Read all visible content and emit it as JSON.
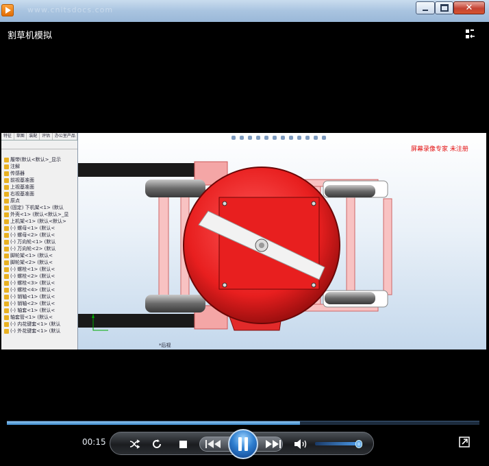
{
  "window": {
    "watermark": "www.cnitsdocs.com",
    "minimize_label": "",
    "maximize_label": "",
    "close_label": "✕"
  },
  "video": {
    "title": "割草机模拟",
    "cad_tabs": [
      "特征",
      "草图",
      "装配",
      "评估",
      "办公室产品"
    ],
    "tree_items": [
      "履带(默认<默认>_显示",
      "注解",
      "传感器",
      "前视基准面",
      "上视基准面",
      "右视基准面",
      "原点",
      "(固定) 下机架<1> (默认",
      "外壳<1> (默认<默认>_显",
      "上机架<1> (默认<默认>",
      "(-) 螺母<1> (默认<",
      "(-) 螺母<2> (默认<",
      "(-) 万向轮<1> (默认",
      "(-) 万向轮<2> (默认",
      "脚轮架<1> (默认<",
      "脚轮架<2> (默认<",
      "(-) 螺栓<1> (默认<",
      "(-) 螺栓<2> (默认<",
      "(-) 螺栓<3> (默认<",
      "(-) 螺栓<4> (默认<",
      "(-) 销轴<1> (默认<",
      "(-) 销轴<2> (默认<",
      "(-) 轴套<1> (默认<",
      "轴套管<1> (默认<",
      "(-) 内花键套<1> (默认",
      "(-) 外花键套<1> (默认"
    ],
    "registration_text": "屏幕录像专家 未注册",
    "view_caption": "*后视"
  },
  "controls": {
    "time": "00:15",
    "progress_fraction": 0.62,
    "volume_fraction": 0.92
  },
  "colors": {
    "accent": "#2f7fd0",
    "mower_red": "#e81f1f",
    "registration_red": "#e31010"
  },
  "icons": [
    "app-icon",
    "minimize-icon",
    "maximize-icon",
    "close-icon",
    "layout-switch-icon",
    "shuffle-icon",
    "repeat-icon",
    "stop-icon",
    "previous-icon",
    "pause-icon",
    "next-icon",
    "volume-icon",
    "fullscreen-icon"
  ]
}
